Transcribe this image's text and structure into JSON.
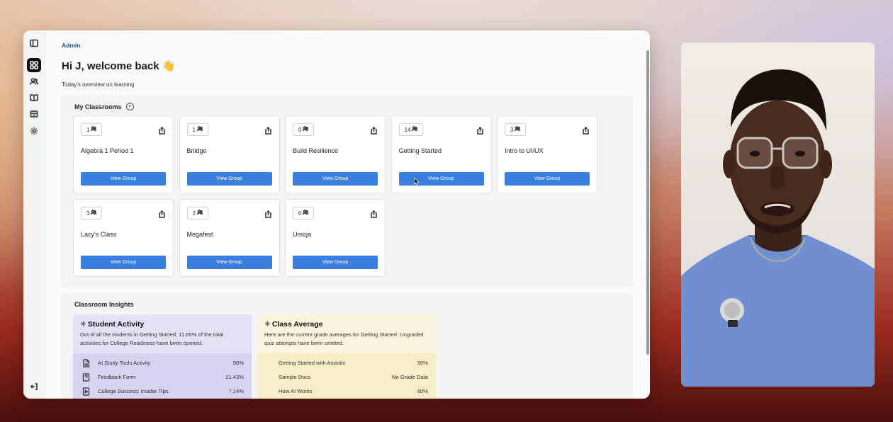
{
  "breadcrumb": "Admin",
  "greeting": "Hi J, welcome back 👋",
  "subtitle": "Today's overview on learning",
  "classrooms": {
    "heading": "My Classrooms",
    "view_label": "View Group",
    "cards": [
      {
        "count": "1",
        "name": "Algebra 1 Period 1"
      },
      {
        "count": "1",
        "name": "Briidge"
      },
      {
        "count": "0",
        "name": "Build Resilience"
      },
      {
        "count": "14",
        "name": "Getting Started"
      },
      {
        "count": "3",
        "name": "Intro to UI/UX"
      },
      {
        "count": "3",
        "name": "Lacy's Class"
      },
      {
        "count": "2",
        "name": "Megafest"
      },
      {
        "count": "0",
        "name": "Umoja"
      }
    ]
  },
  "insights": {
    "heading": "Classroom Insights",
    "student_activity": {
      "title": "Student Activity",
      "description": "Out of all the students in Getting Started, 11.65% of the total activities for College Readiness have been opened.",
      "rows": [
        {
          "icon": "document-icon",
          "label": "AI Study Tools Activity",
          "value": "50%"
        },
        {
          "icon": "question-icon",
          "label": "Feedback Form",
          "value": "21.43%"
        },
        {
          "icon": "video-icon",
          "label": "College Success: Insider Tips",
          "value": "7.14%"
        }
      ],
      "bg": "#e3e1f5",
      "body_bg": "#d6d3f0"
    },
    "class_average": {
      "title": "Class Average",
      "description": "Here are the current grade averages for Getting Started. Ungraded quiz attempts have been omitted.",
      "rows": [
        {
          "label": "Getting Started with Assistiv",
          "value": "50%"
        },
        {
          "label": "Sample Docs",
          "value": "No Grade Data"
        },
        {
          "label": "How AI Works",
          "value": "80%"
        }
      ],
      "bg": "#faf5dc",
      "body_bg": "#f5eec6"
    }
  },
  "colors": {
    "accent": "#3a7ee0",
    "breadcrumb": "#1e4f9a"
  }
}
